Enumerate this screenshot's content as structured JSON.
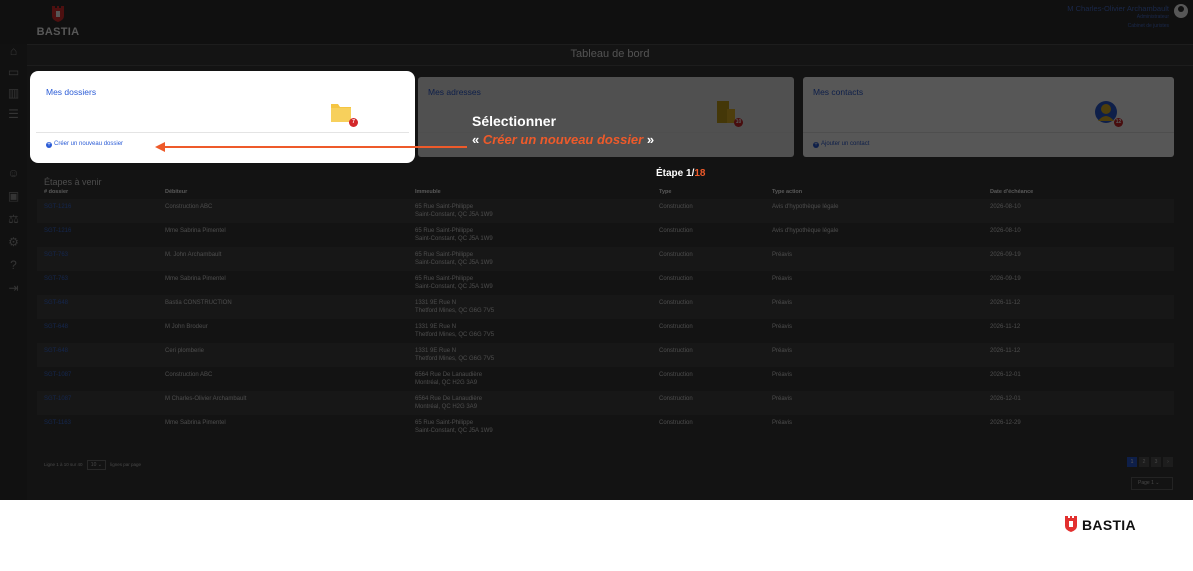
{
  "brand": {
    "name": "BASTIA",
    "accent": "#ee5a2a",
    "link_color": "#2a5bd6"
  },
  "header": {
    "user_name": "M Charles-Olivier Archambault",
    "user_sub1": "Administrateur",
    "user_sub2": "Cabinet de juristes"
  },
  "sidebar": {
    "icons": [
      "home-icon",
      "folder-icon",
      "building-icon",
      "contacts-icon",
      "briefcase-icon",
      "scale-icon",
      "settings-icon",
      "help-icon",
      "logout-icon"
    ]
  },
  "page": {
    "title": "Tableau de bord"
  },
  "cards": [
    {
      "title": "Mes dossiers",
      "link": "Créer un nouveau dossier",
      "badge": "7",
      "icon": "folder-icon"
    },
    {
      "title": "Mes adresses",
      "link": "",
      "badge": "10",
      "icon": "building-icon"
    },
    {
      "title": "Mes contacts",
      "link": "Ajouter un contact",
      "badge": "12",
      "icon": "contacts-icon"
    }
  ],
  "table": {
    "title": "Étapes à venir",
    "headers": [
      "# dossier",
      "Débiteur",
      "Immeuble",
      "Type",
      "Type action",
      "Date d'échéance"
    ],
    "rows": [
      [
        "SGT-1216",
        "Construction ABC",
        "65 Rue Saint-Philippe",
        "Saint-Constant, QC J5A 1W9",
        "Construction",
        "Avis d'hypothèque légale",
        "2026-08-10"
      ],
      [
        "SGT-1216",
        "Mme Sabrina Pimentel",
        "65 Rue Saint-Philippe",
        "Saint-Constant, QC J5A 1W9",
        "Construction",
        "Avis d'hypothèque légale",
        "2026-08-10"
      ],
      [
        "SGT-763",
        "M. John Archambault",
        "65 Rue Saint-Philippe",
        "Saint-Constant, QC J5A 1W9",
        "Construction",
        "Préavis",
        "2026-09-19"
      ],
      [
        "SGT-763",
        "Mme Sabrina Pimentel",
        "65 Rue Saint-Philippe",
        "Saint-Constant, QC J5A 1W9",
        "Construction",
        "Préavis",
        "2026-09-19"
      ],
      [
        "SGT-648",
        "Bastia CONSTRUCTION",
        "1331 9E Rue N",
        "Thetford Mines, QC G6G 7V5",
        "Construction",
        "Préavis",
        "2026-11-12"
      ],
      [
        "SGT-648",
        "M John Brodeur",
        "1331 9E Rue N",
        "Thetford Mines, QC G6G 7V5",
        "Construction",
        "Préavis",
        "2026-11-12"
      ],
      [
        "SGT-648",
        "Ceri plomberie",
        "1331 9E Rue N",
        "Thetford Mines, QC G6G 7V5",
        "Construction",
        "Préavis",
        "2026-11-12"
      ],
      [
        "SGT-1087",
        "Construction ABC",
        "6564 Rue De Lanaudière",
        "Montréal, QC H2G 3A9",
        "Construction",
        "Préavis",
        "2026-12-01"
      ],
      [
        "SGT-1087",
        "M Charles-Olivier Archambault",
        "6564 Rue De Lanaudière",
        "Montréal, QC H2G 3A9",
        "Construction",
        "Préavis",
        "2026-12-01"
      ],
      [
        "SGT-1163",
        "Mme Sabrina Pimentel",
        "65 Rue Saint-Philippe",
        "Saint-Constant, QC J5A 1W9",
        "Construction",
        "Préavis",
        "2026-12-29"
      ]
    ]
  },
  "pagination": {
    "left_text": "Ligne 1 à 10 sur 40",
    "per_page": "10",
    "per_page_suffix": "lignes par page",
    "pages": [
      "1",
      "2",
      "3",
      "›"
    ],
    "page_select": "Page 1"
  },
  "annotation": {
    "line1": "Sélectionner",
    "open_quote": "« ",
    "highlight": "Créer un nouveau dossier",
    "close_quote": " »",
    "step_prefix": "Étape 1/",
    "step_total": "18"
  },
  "footer": {
    "brand": "BASTIA"
  }
}
